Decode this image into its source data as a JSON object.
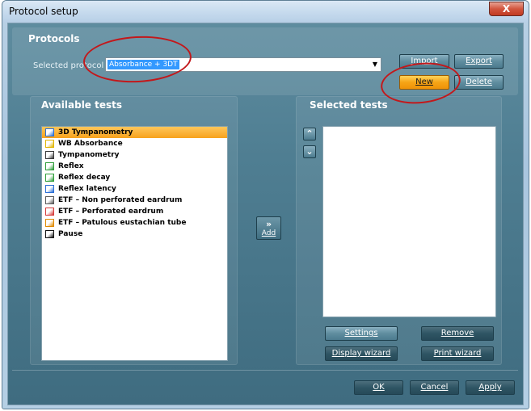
{
  "window": {
    "title": "Protocol setup",
    "close_glyph": "X"
  },
  "protocols": {
    "header": "Protocols",
    "selected_label": "Selected protocol :",
    "selected_value": "Absorbance + 3DT",
    "dropdown_glyph": "▼",
    "buttons": {
      "import": "Import",
      "export": "Export",
      "new": "New",
      "delete": "Delete"
    }
  },
  "available": {
    "header": "Available tests",
    "items": [
      {
        "label": "3D Tympanometry",
        "icon": "tympanometry-3d-icon",
        "color": "#2b6fd6",
        "selected": true
      },
      {
        "label": "WB Absorbance",
        "icon": "absorbance-icon",
        "color": "#e0b500"
      },
      {
        "label": "Tympanometry",
        "icon": "tympanometry-icon",
        "color": "#3a3a3a"
      },
      {
        "label": "Reflex",
        "icon": "reflex-icon",
        "color": "#2f9e3a"
      },
      {
        "label": "Reflex decay",
        "icon": "reflex-decay-icon",
        "color": "#2f9e3a"
      },
      {
        "label": "Reflex latency",
        "icon": "reflex-latency-icon",
        "color": "#2b6fd6"
      },
      {
        "label": "ETF – Non perforated eardrum",
        "icon": "etf-non-perforated-icon",
        "color": "#5a5a5a"
      },
      {
        "label": "ETF – Perforated eardrum",
        "icon": "etf-perforated-icon",
        "color": "#d63a3a"
      },
      {
        "label": "ETF – Patulous eustachian tube",
        "icon": "etf-patulous-icon",
        "color": "#e08a00"
      },
      {
        "label": "Pause",
        "icon": "pause-icon",
        "color": "#111111"
      }
    ]
  },
  "selected": {
    "header": "Selected tests",
    "move_up_glyph": "⌃",
    "move_down_glyph": "⌄",
    "buttons": {
      "settings": "Settings",
      "remove": "Remove",
      "display_wizard": "Display wizard",
      "print_wizard": "Print wizard"
    }
  },
  "add_button": {
    "arrows": "»",
    "label": "Add"
  },
  "footer": {
    "ok": "OK",
    "cancel": "Cancel",
    "apply": "Apply"
  },
  "colors": {
    "accent_orange": "#f6a416",
    "annotation_red": "#c3181b",
    "selection_blue": "#3399ff"
  }
}
